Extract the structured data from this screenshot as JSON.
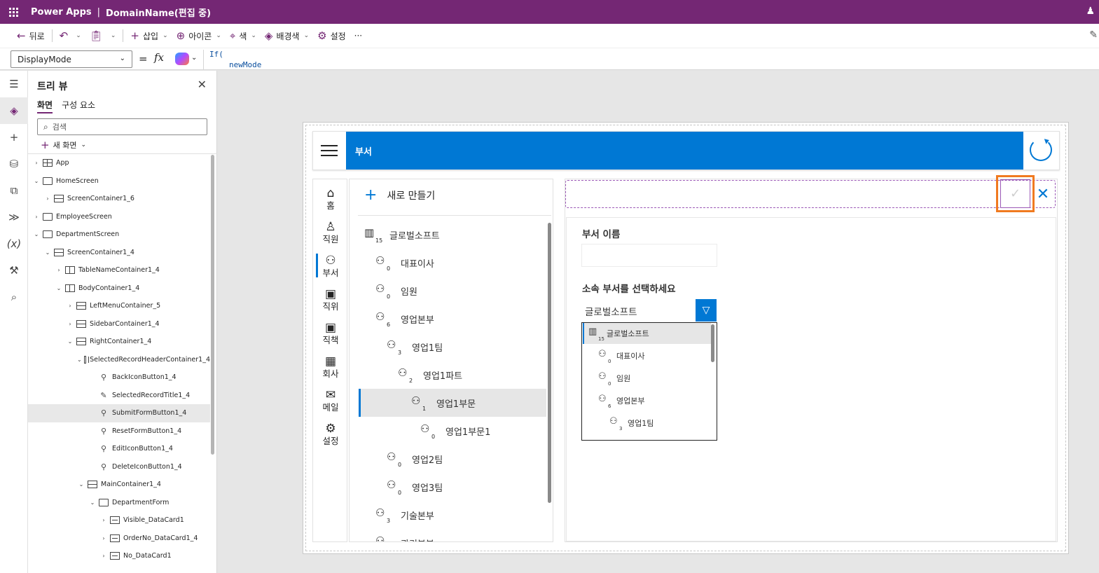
{
  "titlebar": {
    "app_name": "Power Apps",
    "separator": "|",
    "doc_name": "DomainName(편집 중)"
  },
  "commandbar": {
    "back_label": "뒤로",
    "insert_label": "삽입",
    "icon_label": "아이콘",
    "color_label": "색",
    "background_label": "배경색",
    "settings_label": "설정",
    "more_label": "···"
  },
  "formulabar": {
    "property": "DisplayMode",
    "equals": "=",
    "fx": "fx",
    "code_line1": "If(",
    "code_line2": "newMode"
  },
  "treeview": {
    "title": "트리 뷰",
    "tabs": [
      "화면",
      "구성 요소"
    ],
    "search_placeholder": "검색",
    "new_screen_label": "새 화면",
    "items": [
      {
        "label": "App",
        "icon": "app",
        "indent": 0,
        "chev": "›"
      },
      {
        "label": "HomeScreen",
        "icon": "screen",
        "indent": 0,
        "chev": "⌄"
      },
      {
        "label": "ScreenContainer1_6",
        "icon": "hcont",
        "indent": 1,
        "chev": "›"
      },
      {
        "label": "EmployeeScreen",
        "icon": "screen",
        "indent": 0,
        "chev": "›"
      },
      {
        "label": "DepartmentScreen",
        "icon": "screen",
        "indent": 0,
        "chev": "⌄"
      },
      {
        "label": "ScreenContainer1_4",
        "icon": "hcont",
        "indent": 1,
        "chev": "⌄"
      },
      {
        "label": "TableNameContainer1_4",
        "icon": "vcont",
        "indent": 2,
        "chev": "›"
      },
      {
        "label": "BodyContainer1_4",
        "icon": "vcont",
        "indent": 2,
        "chev": "⌄"
      },
      {
        "label": "LeftMenuContainer_5",
        "icon": "hcont",
        "indent": 3,
        "chev": "›"
      },
      {
        "label": "SidebarContainer1_4",
        "icon": "hcont",
        "indent": 3,
        "chev": "›"
      },
      {
        "label": "RightContainer1_4",
        "icon": "hcont",
        "indent": 3,
        "chev": "⌄"
      },
      {
        "label": "SelectedRecordHeaderContainer1_4",
        "icon": "vcont",
        "indent": 4,
        "chev": "⌄"
      },
      {
        "label": "BackIconButton1_4",
        "icon": "btn",
        "indent": 5,
        "chev": ""
      },
      {
        "label": "SelectedRecordTitle1_4",
        "icon": "edit",
        "indent": 5,
        "chev": ""
      },
      {
        "label": "SubmitFormButton1_4",
        "icon": "btn",
        "indent": 5,
        "chev": "",
        "selected": true
      },
      {
        "label": "ResetFormButton1_4",
        "icon": "btn",
        "indent": 5,
        "chev": ""
      },
      {
        "label": "EditIconButton1_4",
        "icon": "btn",
        "indent": 5,
        "chev": ""
      },
      {
        "label": "DeleteIconButton1_4",
        "icon": "btn",
        "indent": 5,
        "chev": ""
      },
      {
        "label": "MainContainer1_4",
        "icon": "hcont",
        "indent": 4,
        "chev": "⌄"
      },
      {
        "label": "DepartmentForm",
        "icon": "form",
        "indent": 5,
        "chev": "⌄"
      },
      {
        "label": "Visible_DataCard1",
        "icon": "card",
        "indent": 6,
        "chev": "›"
      },
      {
        "label": "OrderNo_DataCard1_4",
        "icon": "card",
        "indent": 6,
        "chev": "›"
      },
      {
        "label": "No_DataCard1",
        "icon": "card",
        "indent": 6,
        "chev": "›"
      }
    ]
  },
  "app": {
    "header_title": "부서",
    "left_menu": [
      {
        "label": "홈",
        "icon": "⌂"
      },
      {
        "label": "직원",
        "icon": "♙"
      },
      {
        "label": "부서",
        "icon": "⚇",
        "active": true
      },
      {
        "label": "직위",
        "icon": "▣"
      },
      {
        "label": "직책",
        "icon": "▣"
      },
      {
        "label": "회사",
        "icon": "▦"
      },
      {
        "label": "메일",
        "icon": "✉"
      },
      {
        "label": "설정",
        "icon": "⚙"
      }
    ],
    "new_button_label": "새로 만들기",
    "departments": [
      {
        "name": "글로벌소프트",
        "count": "15",
        "level": 0,
        "type": "company"
      },
      {
        "name": "대표이사",
        "count": "0",
        "level": 1
      },
      {
        "name": "임원",
        "count": "0",
        "level": 1
      },
      {
        "name": "영업본부",
        "count": "6",
        "level": 1
      },
      {
        "name": "영업1팀",
        "count": "3",
        "level": 2
      },
      {
        "name": "영업1파트",
        "count": "2",
        "level": 3
      },
      {
        "name": "영업1부문",
        "count": "1",
        "level": 4,
        "selected": true
      },
      {
        "name": "영업1부문1",
        "count": "0",
        "level": 5
      },
      {
        "name": "영업2팀",
        "count": "0",
        "level": 2
      },
      {
        "name": "영업3팀",
        "count": "0",
        "level": 2
      },
      {
        "name": "기술본부",
        "count": "3",
        "level": 1
      },
      {
        "name": "관리본부",
        "count": "",
        "level": 1
      }
    ],
    "form": {
      "dept_name_label": "부서 이름",
      "dept_name_value": "",
      "parent_label": "소속 부서를 선택하세요",
      "parent_value": "글로벌소프트",
      "dropdown_items": [
        {
          "name": "글로벌소프트",
          "count": "15",
          "level": 0,
          "type": "company"
        },
        {
          "name": "대표이사",
          "count": "0",
          "level": 1
        },
        {
          "name": "임원",
          "count": "0",
          "level": 1
        },
        {
          "name": "영업본부",
          "count": "6",
          "level": 1
        },
        {
          "name": "영업1팀",
          "count": "3",
          "level": 2
        }
      ]
    }
  },
  "colors": {
    "brand": "#742774",
    "accent": "#0078d4",
    "highlight": "#f07a20"
  }
}
